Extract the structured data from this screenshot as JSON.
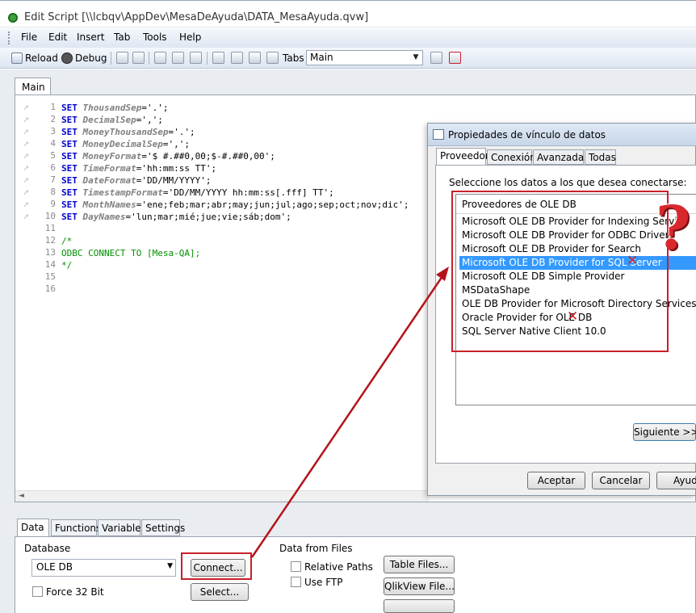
{
  "window": {
    "title": "Edit Script [\\\\lcbqv\\AppDev\\MesaDeAyuda\\DATA_MesaAyuda.qvw]"
  },
  "menu": [
    "File",
    "Edit",
    "Insert",
    "Tab",
    "Tools",
    "Help"
  ],
  "toolbar": {
    "reload_label": "Reload",
    "debug_label": "Debug",
    "tabs_label": "Tabs",
    "tab_select_value": "Main"
  },
  "editor": {
    "tab_label": "Main",
    "line_numbers": [
      "1",
      "2",
      "3",
      "4",
      "5",
      "6",
      "7",
      "8",
      "9",
      "10",
      "11",
      "12",
      "13",
      "14",
      "15",
      "16"
    ]
  },
  "code": [
    {
      "kw": "SET ",
      "var": "ThousandSep",
      "rest": "='.';"
    },
    {
      "kw": "SET ",
      "var": "DecimalSep",
      "rest": "=',';"
    },
    {
      "kw": "SET ",
      "var": "MoneyThousandSep",
      "rest": "='.';"
    },
    {
      "kw": "SET ",
      "var": "MoneyDecimalSep",
      "rest": "=',';"
    },
    {
      "kw": "SET ",
      "var": "MoneyFormat",
      "rest": "='$ #.##0,00;$-#.##0,00';"
    },
    {
      "kw": "SET ",
      "var": "TimeFormat",
      "rest": "='hh:mm:ss TT';"
    },
    {
      "kw": "SET ",
      "var": "DateFormat",
      "rest": "='DD/MM/YYYY';"
    },
    {
      "kw": "SET ",
      "var": "TimestampFormat",
      "rest": "='DD/MM/YYYY hh:mm:ss[.fff] TT';"
    },
    {
      "kw": "SET ",
      "var": "MonthNames",
      "rest": "='ene;feb;mar;abr;may;jun;jul;ago;sep;oct;nov;dic';"
    },
    {
      "kw": "SET ",
      "var": "DayNames",
      "rest": "='lun;mar;mié;jue;vie;sáb;dom';"
    }
  ],
  "comment_lines": [
    "/*",
    "ODBC CONNECT TO [Mesa-QA];",
    "*/"
  ],
  "bottom": {
    "tabs": [
      "Data",
      "Functions",
      "Variables",
      "Settings"
    ],
    "database_label": "Database",
    "database_value": "OLE DB",
    "connect_label": "Connect...",
    "select_label": "Select...",
    "force32_label": "Force 32 Bit",
    "data_from_files_label": "Data from Files",
    "relative_paths_label": "Relative Paths",
    "use_ftp_label": "Use FTP",
    "table_files_label": "Table Files...",
    "qlikview_file_label": "QlikView File..."
  },
  "dialog": {
    "title": "Propiedades de vínculo de datos",
    "tabs": [
      "Proveedor",
      "Conexión",
      "Avanzadas",
      "Todas"
    ],
    "prompt": "Seleccione los datos a los que desea conectarse:",
    "list_header": "Proveedores de OLE DB",
    "providers": [
      "Microsoft OLE DB Provider for Indexing Service",
      "Microsoft OLE DB Provider for ODBC Drivers",
      "Microsoft OLE DB Provider for Search",
      "Microsoft OLE DB Provider for SQL Server",
      "Microsoft OLE DB Simple Provider",
      "MSDataShape",
      "OLE DB Provider for Microsoft Directory Services",
      "Oracle Provider for OLE DB",
      "SQL Server Native Client 10.0"
    ],
    "selected_index": 3,
    "next_label": "Siguiente >>",
    "accept_label": "Aceptar",
    "cancel_label": "Cancelar",
    "help_label": "Ayuda"
  },
  "annotations": {
    "question_mark": "?",
    "cross_mark": "✕",
    "accent_color": "#c8202a"
  }
}
